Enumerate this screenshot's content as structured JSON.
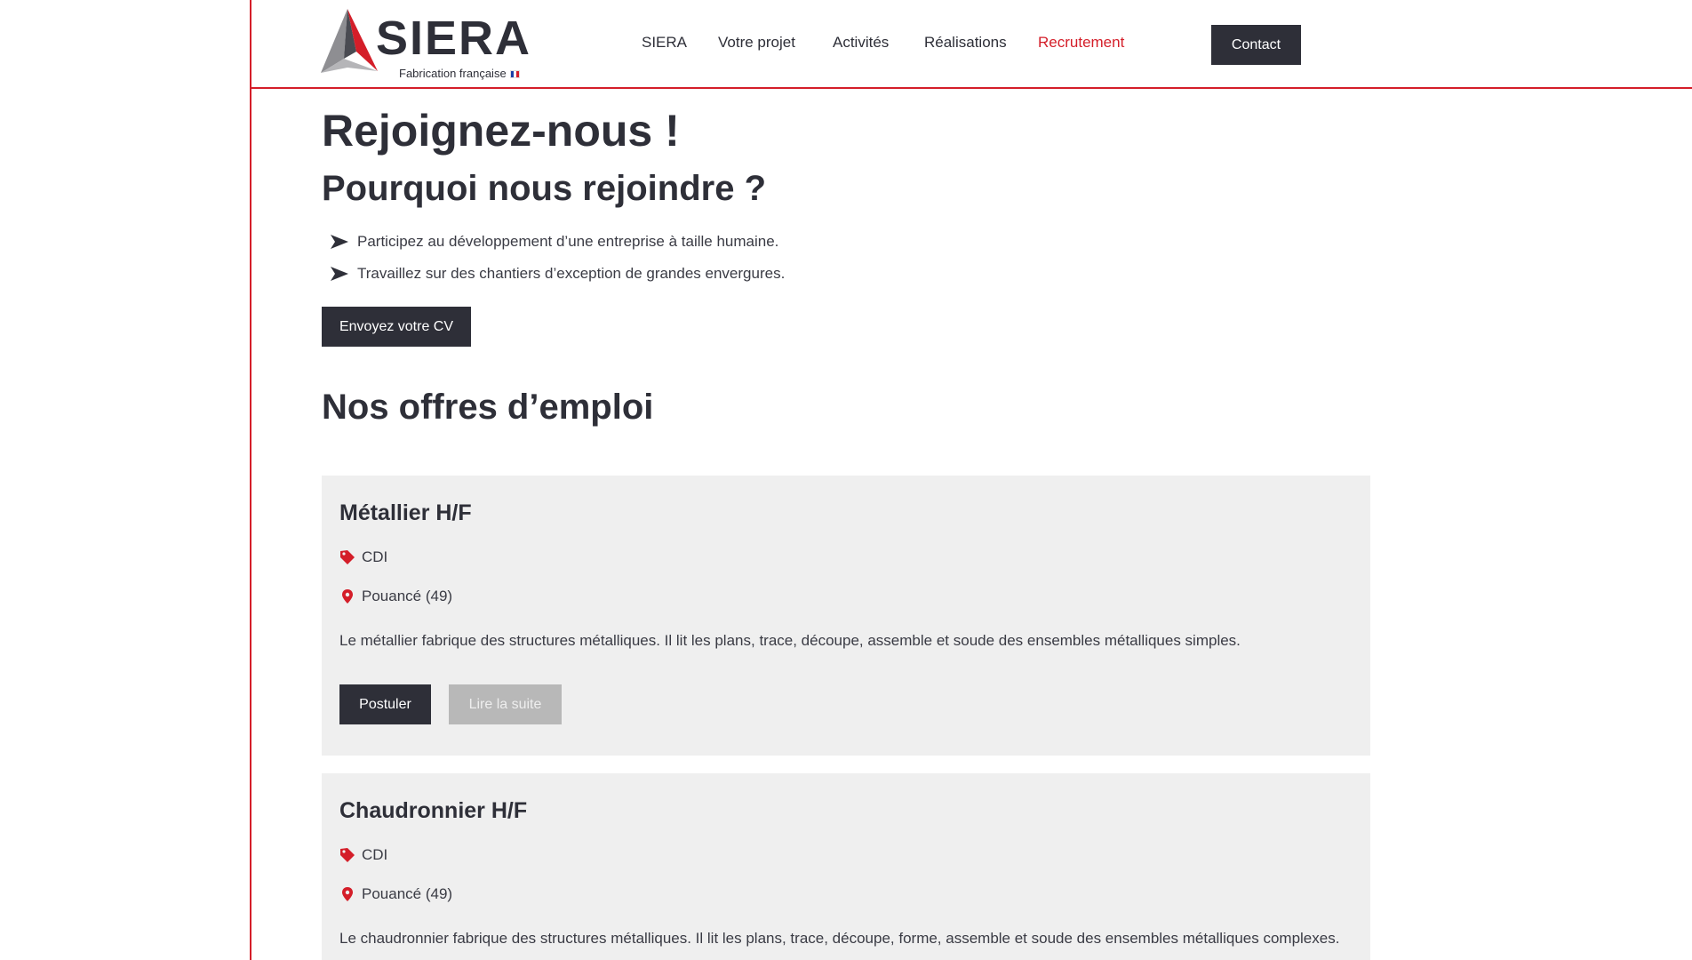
{
  "brand": {
    "name": "SIERA",
    "tagline": "Fabrication française",
    "accent": "#d41e29",
    "dark": "#2e2f38"
  },
  "nav": {
    "items": [
      {
        "label": "SIERA"
      },
      {
        "label": "Votre projet"
      },
      {
        "label": "Activités"
      },
      {
        "label": "Réalisations"
      },
      {
        "label": "Recrutement",
        "active": true
      }
    ],
    "contact_label": "Contact"
  },
  "hero": {
    "title": "Rejoignez-nous !",
    "subtitle": "Pourquoi nous rejoindre ?",
    "bullets": [
      "Participez au développement d’une entreprise à taille humaine.",
      "Travaillez sur des chantiers d’exception de grandes envergures."
    ],
    "cv_button": "Envoyez votre CV"
  },
  "jobs": {
    "title": "Nos offres d’emploi",
    "items": [
      {
        "title": "Métallier H/F",
        "contract": "CDI",
        "location": "Pouancé (49)",
        "description": "Le métallier fabrique des structures métalliques. Il lit les plans, trace, découpe, assemble et soude des ensembles métalliques simples.",
        "apply_label": "Postuler",
        "more_label": "Lire la suite"
      },
      {
        "title": "Chaudronnier H/F",
        "contract": "CDI",
        "location": "Pouancé (49)",
        "description": "Le chaudronnier fabrique des structures métalliques. Il lit les plans, trace, découpe, forme, assemble et soude des ensembles métalliques complexes."
      }
    ]
  },
  "icons": [
    "logo-triangle-icon",
    "arrow-right-icon",
    "tag-icon",
    "location-pin-icon"
  ]
}
